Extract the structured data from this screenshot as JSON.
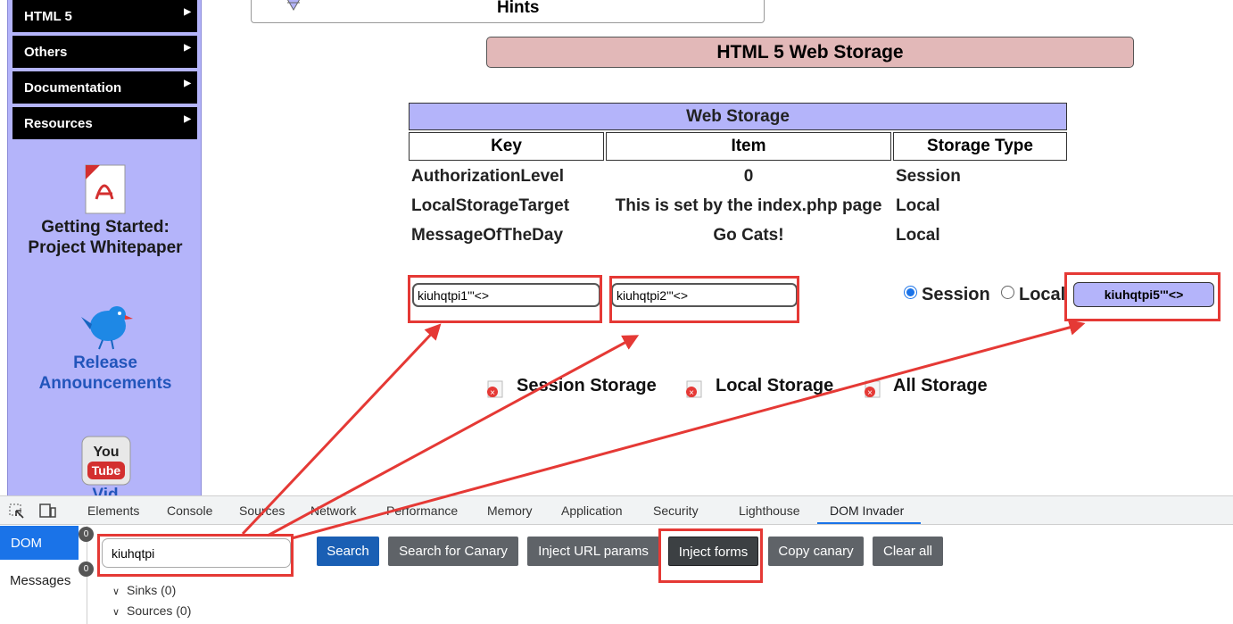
{
  "nav": {
    "menu": [
      {
        "label": "HTML 5"
      },
      {
        "label": "Others"
      },
      {
        "label": "Documentation"
      },
      {
        "label": "Resources"
      }
    ],
    "promos": {
      "whitepaper_line1": "Getting Started:",
      "whitepaper_line2": "Project Whitepaper",
      "release_line1": "Release",
      "release_line2": "Announcements",
      "video_partial": "Vid",
      "youtube_line1": "You",
      "youtube_line2": "Tube"
    }
  },
  "hints": {
    "title": "Hints"
  },
  "page": {
    "title": "HTML 5 Web Storage"
  },
  "table": {
    "caption": "Web Storage",
    "headers": [
      "Key",
      "Item",
      "Storage Type"
    ],
    "rows": [
      [
        "AuthorizationLevel",
        "0",
        "Session"
      ],
      [
        "LocalStorageTarget",
        "This is set by the index.php page",
        "Local"
      ],
      [
        "MessageOfTheDay",
        "Go Cats!",
        "Local"
      ]
    ]
  },
  "form": {
    "key_value": "kiuhqtpi1'\"<>",
    "item_value": "kiuhqtpi2'\"<>",
    "radio_session": "Session",
    "radio_local": "Local",
    "selected": "Session",
    "button_label": "kiuhqtpi5'\"<>"
  },
  "links": {
    "session": "Session Storage",
    "local": "Local Storage",
    "all": "All Storage"
  },
  "devtools": {
    "tabs": [
      "Elements",
      "Console",
      "Sources",
      "Network",
      "Performance",
      "Memory",
      "Application",
      "Security",
      "Lighthouse",
      "DOM Invader"
    ],
    "active_tab": "DOM Invader",
    "sidebar": {
      "dom": "DOM",
      "messages": "Messages",
      "dom_count": "0",
      "messages_count": "0"
    },
    "canary_value": "kiuhqtpi",
    "buttons": {
      "search": "Search",
      "search_canary": "Search for Canary",
      "inject_url": "Inject URL params",
      "inject_forms": "Inject forms",
      "copy_canary": "Copy canary",
      "clear_all": "Clear all"
    },
    "tree": {
      "sinks": "Sinks (0)",
      "sources": "Sources (0)"
    }
  },
  "colors": {
    "nav_bg": "#b4b4fa",
    "title_bg": "#e2b8b8",
    "highlight": "#e53935",
    "devtools_accent": "#1a73e8"
  }
}
